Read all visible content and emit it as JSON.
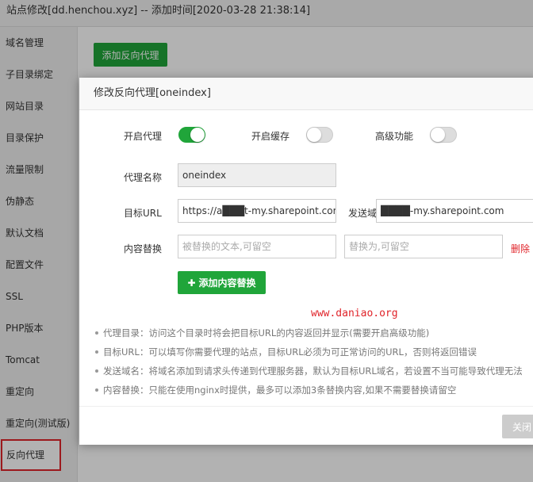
{
  "window": {
    "title": "站点修改[dd.henchou.xyz] -- 添加时间[2020-03-28 21:38:14]"
  },
  "sidebar": {
    "items": [
      {
        "label": "域名管理"
      },
      {
        "label": "子目录绑定"
      },
      {
        "label": "网站目录"
      },
      {
        "label": "目录保护"
      },
      {
        "label": "流量限制"
      },
      {
        "label": "伪静态"
      },
      {
        "label": "默认文档"
      },
      {
        "label": "配置文件"
      },
      {
        "label": "SSL"
      },
      {
        "label": "PHP版本"
      },
      {
        "label": "Tomcat"
      },
      {
        "label": "重定向"
      },
      {
        "label": "重定向(测试版)"
      },
      {
        "label": "反向代理",
        "active": true
      }
    ]
  },
  "main": {
    "add_proxy_label": "添加反向代理"
  },
  "modal": {
    "title": "修改反向代理[oneindex]",
    "toggles": {
      "proxy": {
        "label": "开启代理",
        "on": true
      },
      "cache": {
        "label": "开启缓存",
        "on": false
      },
      "advanced": {
        "label": "高级功能",
        "on": false
      }
    },
    "proxy_name": {
      "label": "代理名称",
      "value": "oneindex"
    },
    "target_url": {
      "label": "目标URL",
      "value": "https://a███t-my.sharepoint.com"
    },
    "send_domain": {
      "label": "发送域名",
      "value": "████-my.sharepoint.com"
    },
    "content_replace": {
      "label": "内容替换",
      "from_placeholder": "被替换的文本,可留空",
      "to_placeholder": "替换为,可留空",
      "delete_label": "删除",
      "add_label": "添加内容替换"
    },
    "notes": [
      "代理目录：访问这个目录时将会把目标URL的内容返回并显示(需要开启高级功能)",
      "目标URL：可以填写你需要代理的站点，目标URL必须为可正常访问的URL，否则将返回错误",
      "发送域名：将域名添加到请求头传递到代理服务器，默认为目标URL域名，若设置不当可能导致代理无法",
      "内容替换：只能在使用nginx时提供，最多可以添加3条替换内容,如果不需要替换请留空"
    ],
    "close_label": "关闭"
  },
  "watermark": "www.daniao.org",
  "colors": {
    "accent_green": "#20a53a",
    "danger_red": "#e0242a"
  }
}
